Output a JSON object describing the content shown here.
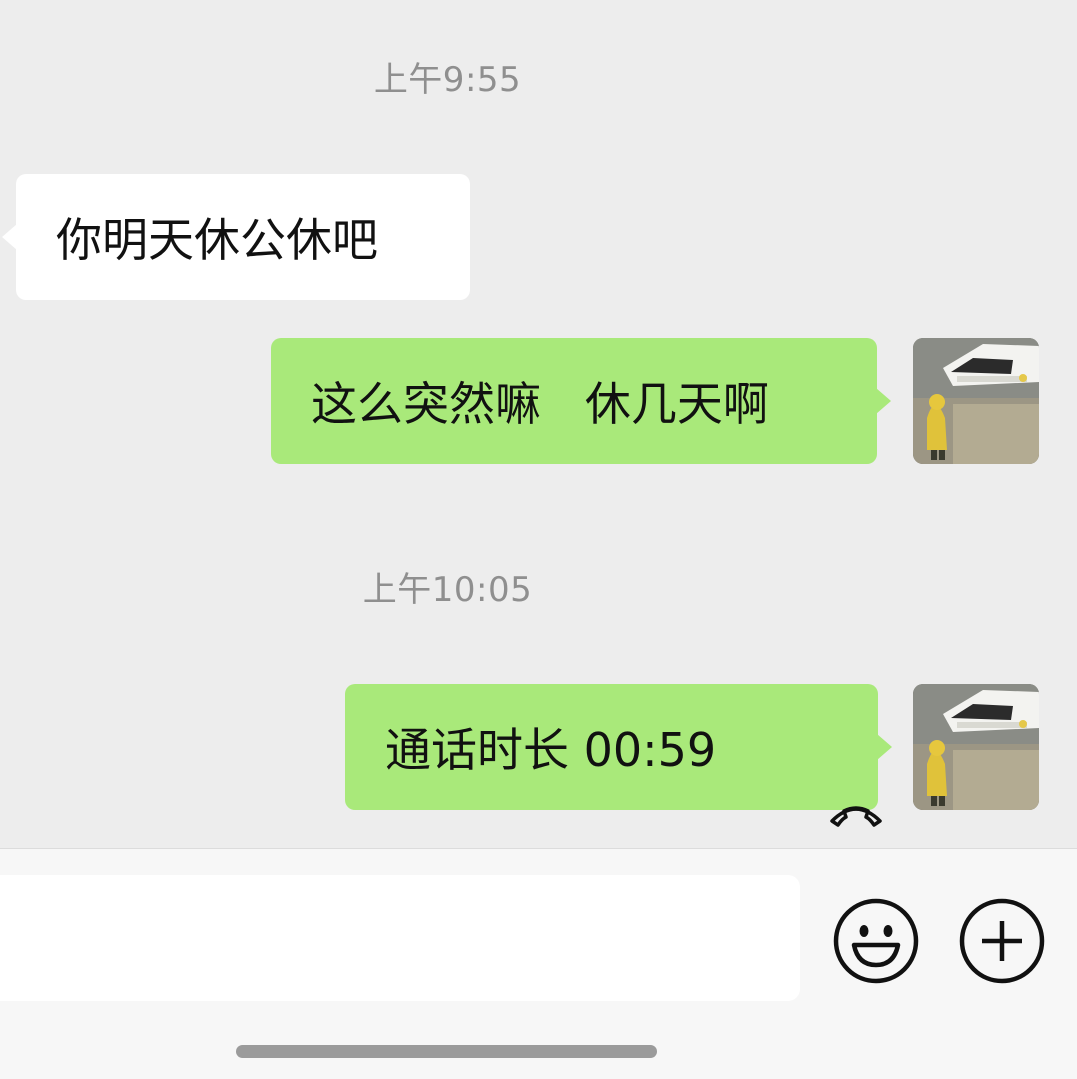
{
  "chat": {
    "timestamps": [
      "上午9:55",
      "上午10:05"
    ],
    "messages": [
      {
        "direction": "incoming",
        "text": "你明天休公休吧"
      },
      {
        "direction": "outgoing",
        "text": "这么突然嘛   休几天啊"
      },
      {
        "direction": "outgoing",
        "text": "通话时长 00:59",
        "icon": "hang-up-phone-icon"
      }
    ]
  },
  "input": {
    "placeholder": "",
    "value": ""
  },
  "icons": {
    "emoji": "smiley-face-icon",
    "more": "plus-circle-icon"
  },
  "colors": {
    "background": "#ededed",
    "incoming_bubble": "#ffffff",
    "outgoing_bubble": "#a9e97a",
    "timestamp": "#8f8f8f",
    "input_bar": "#f7f7f7"
  }
}
